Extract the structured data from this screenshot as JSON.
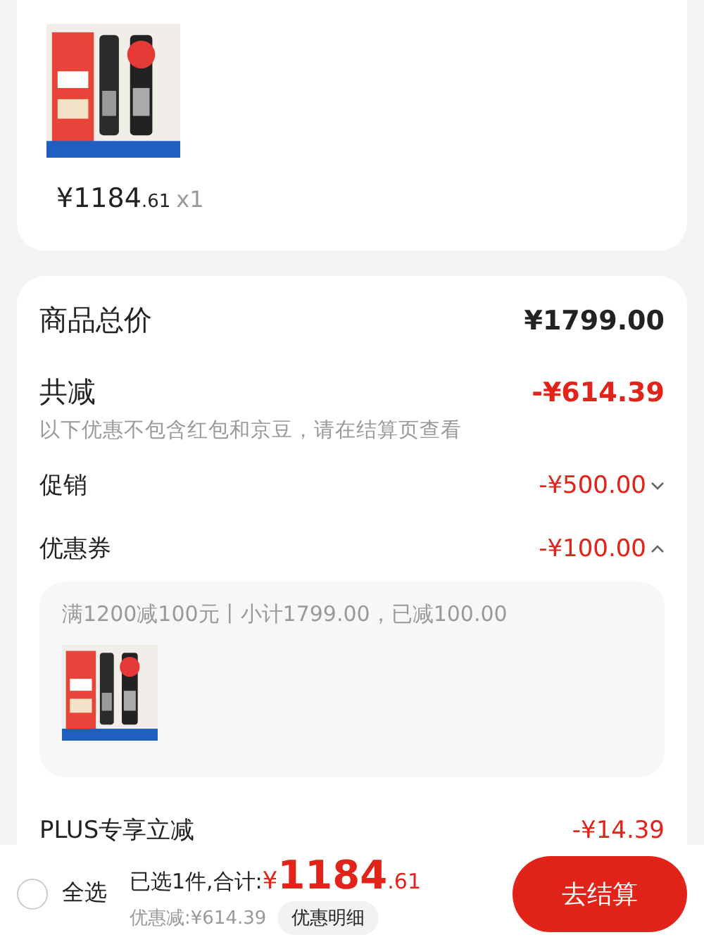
{
  "product_card": {
    "price_main": "¥1184",
    "price_decimal": ".61",
    "quantity": "x1"
  },
  "summary": {
    "rows": [
      {
        "kind": "total",
        "label": "商品总价",
        "value": "¥1799.00"
      },
      {
        "kind": "discount_total",
        "label": "共减",
        "value": "-¥614.39",
        "note": "以下优惠不包含红包和京豆，请在结算页查看"
      },
      {
        "kind": "expandable",
        "label": "促销",
        "value": "-¥500.00",
        "expanded": false
      },
      {
        "kind": "expandable",
        "label": "优惠券",
        "value": "-¥100.00",
        "expanded": true,
        "detail": {
          "text": "满1200减100元丨小计1799.00，已减100.00"
        }
      },
      {
        "kind": "plain",
        "label": "PLUS专享立减",
        "value": "-¥14.39"
      }
    ]
  },
  "bottom_bar": {
    "select_all": {
      "label": "全选",
      "checked": false
    },
    "selected_summary": "已选1件,合计:",
    "total_symbol": "¥",
    "total_main": "1184",
    "total_decimal": ".61",
    "discount": "优惠减:¥614.39",
    "detail_button": "优惠明细",
    "checkout_button": "去结算"
  }
}
